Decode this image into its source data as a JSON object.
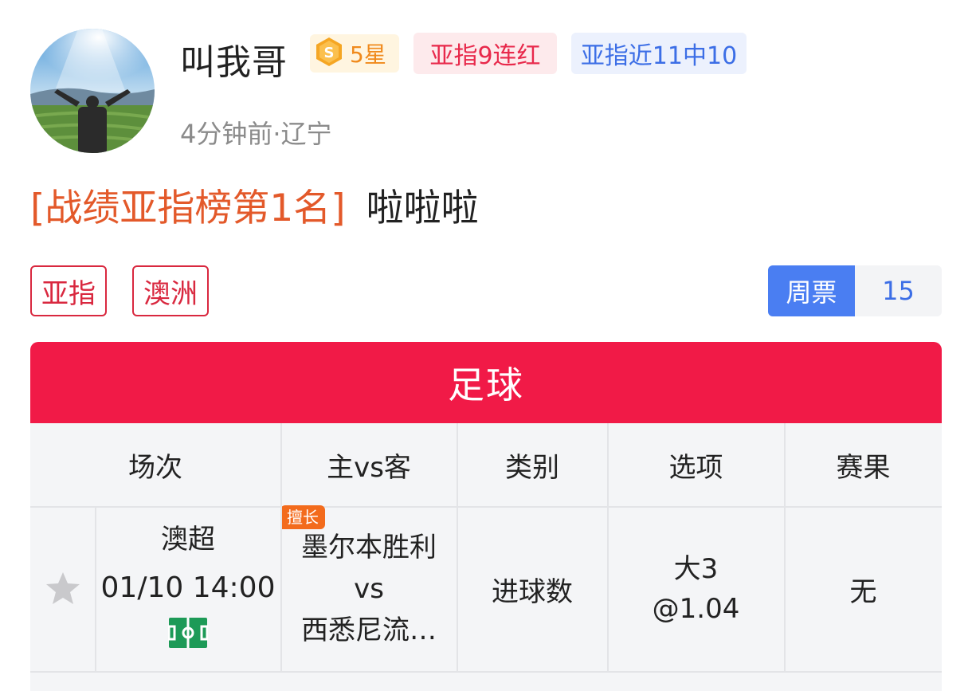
{
  "user": {
    "name": "叫我哥",
    "star_level": "5星",
    "tag_streak": "亚指9连红",
    "tag_record": "亚指近11中10",
    "time_location": "4分钟前·辽宁"
  },
  "post": {
    "rank_title": "[战绩亚指榜第1名]",
    "content": "啦啦啦"
  },
  "chips": [
    "亚指",
    "澳洲"
  ],
  "ticket": {
    "label": "周票",
    "value": "15"
  },
  "card": {
    "title": "足球",
    "headers": [
      "场次",
      "主vs客",
      "类别",
      "选项",
      "赛果"
    ],
    "match": {
      "league": "澳超",
      "datetime": "01/10 14:00",
      "badge": "擅长",
      "home": "墨尔本胜利",
      "vs": "vs",
      "away": "西悉尼流…",
      "category": "进球数",
      "option_line1": "大3",
      "option_line2": "@1.04",
      "result": "无"
    }
  },
  "colors": {
    "card_header": "#f11a47",
    "rank_title": "#e3592a",
    "chip_border": "#d9283f",
    "ticket_label": "#4a7ef2"
  },
  "icons": [
    "medal-icon",
    "star-icon",
    "pitch-icon"
  ]
}
